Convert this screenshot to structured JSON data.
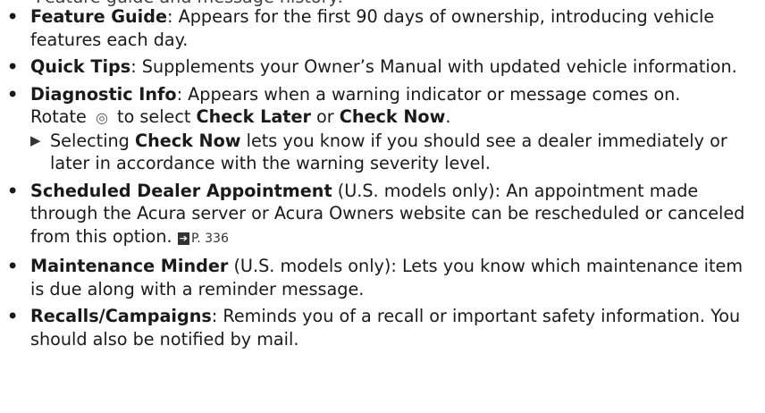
{
  "top_fragment": "Feature guide and message history:",
  "bullet_glyph": "•",
  "note_glyph": "▶",
  "knob_glyph": "◎",
  "xref_glyph": "➔",
  "items": [
    {
      "term": "Feature Guide",
      "sep": ": ",
      "desc": "Appears for the first 90 days of ownership, introducing vehicle features each day."
    },
    {
      "term": "Quick Tips",
      "sep": ": ",
      "desc": "Supplements your Owner’s Manual with updated vehicle information."
    },
    {
      "term": "Diagnostic Info",
      "sep": ": ",
      "desc": "Appears when a warning indicator or message comes on.",
      "rotate": "Rotate",
      "to_select": "to select",
      "opt1": "Check Later",
      "or": "or",
      "opt2": "Check Now",
      "period": ".",
      "note_prefix": "Selecting",
      "note_kw": "Check Now",
      "note_rest": "lets you know if you should see a dealer immediately or later in accordance with the warning severity level."
    },
    {
      "term": "Scheduled Dealer Appointment",
      "qualifier": " (U.S. models only): ",
      "desc": "An appointment made through the Acura server or Acura Owners website can be rescheduled or canceled from this option.",
      "page_ref": "P. 336"
    },
    {
      "term": "Maintenance Minder",
      "qualifier": " (U.S. models only): ",
      "desc": "Lets you know which maintenance item is due along with a reminder message."
    },
    {
      "term": "Recalls/Campaigns",
      "sep": ": ",
      "desc": "Reminds you of a recall or important safety information. You should also be notified by mail."
    }
  ]
}
